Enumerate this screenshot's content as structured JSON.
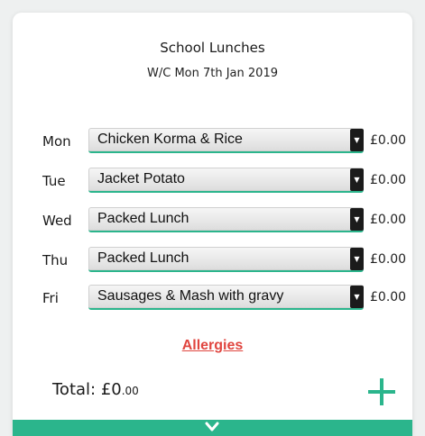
{
  "header": {
    "title": "School Lunches",
    "subtitle": "W/C Mon 7th Jan 2019"
  },
  "days": [
    {
      "day": "Mon",
      "meal": "Chicken Korma & Rice",
      "price": "£0.00"
    },
    {
      "day": "Tue",
      "meal": "Jacket Potato",
      "price": "£0.00"
    },
    {
      "day": "Wed",
      "meal": "Packed Lunch",
      "price": "£0.00"
    },
    {
      "day": "Thu",
      "meal": "Packed Lunch",
      "price": "£0.00"
    },
    {
      "day": "Fri",
      "meal": "Sausages & Mash with gravy",
      "price": "£0.00"
    }
  ],
  "allergies_label": "Allergies",
  "total": {
    "label": "Total: £0",
    "pence": ".00"
  },
  "icons": {
    "add": "plus-icon",
    "expand": "chevron-down-icon",
    "dropdown": "dropdown-arrow-icon"
  },
  "colors": {
    "accent": "#2bb58c",
    "link": "#e0453f",
    "background": "#eef0f0"
  }
}
